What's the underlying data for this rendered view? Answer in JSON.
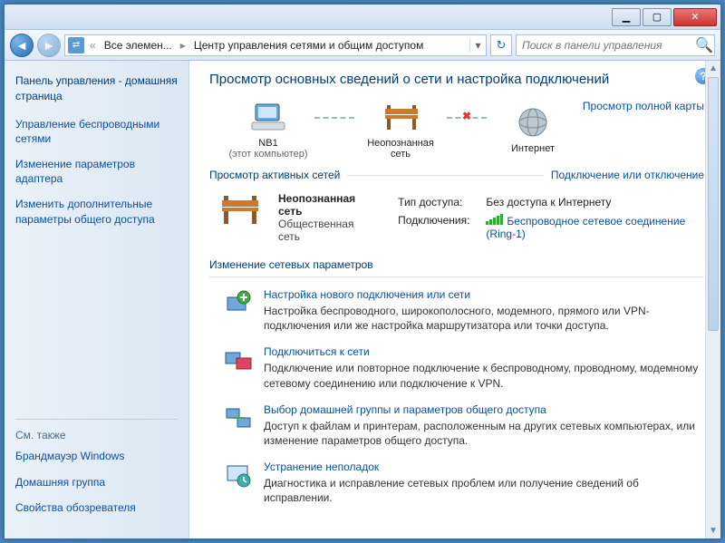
{
  "address": {
    "seg1": "Все элемен...",
    "seg2": "Центр управления сетями и общим доступом"
  },
  "search": {
    "placeholder": "Поиск в панели управления"
  },
  "sidebar": {
    "home": "Панель управления - домашняя страница",
    "links": [
      "Управление беспроводными сетями",
      "Изменение параметров адаптера",
      "Изменить дополнительные параметры общего доступа"
    ],
    "seealso_title": "См. также",
    "seealso": [
      "Брандмауэр Windows",
      "Домашняя группа",
      "Свойства обозревателя"
    ]
  },
  "main": {
    "title": "Просмотр основных сведений о сети и настройка подключений",
    "viewfull": "Просмотр полной карты",
    "nodes": {
      "comp_name": "NB1",
      "comp_sub": "(этот компьютер)",
      "unknown": "Неопознанная сеть",
      "internet": "Интернет"
    },
    "active_title": "Просмотр активных сетей",
    "active_link": "Подключение или отключение",
    "active": {
      "name": "Неопознанная сеть",
      "type": "Общественная сеть",
      "access_label": "Тип доступа:",
      "access_value": "Без доступа к Интернету",
      "conn_label": "Подключения:",
      "conn_value": "Беспроводное сетевое соединение (Ring-1)"
    },
    "change_title": "Изменение сетевых параметров",
    "options": [
      {
        "title": "Настройка нового подключения или сети",
        "desc": "Настройка беспроводного, широкополосного, модемного, прямого или VPN-подключения или же настройка маршрутизатора или точки доступа."
      },
      {
        "title": "Подключиться к сети",
        "desc": "Подключение или повторное подключение к беспроводному, проводному, модемному сетевому соединению или подключение к VPN."
      },
      {
        "title": "Выбор домашней группы и параметров общего доступа",
        "desc": "Доступ к файлам и принтерам, расположенным на других сетевых компьютерах, или изменение параметров общего доступа."
      },
      {
        "title": "Устранение неполадок",
        "desc": "Диагностика и исправление сетевых проблем или получение сведений об исправлении."
      }
    ]
  }
}
